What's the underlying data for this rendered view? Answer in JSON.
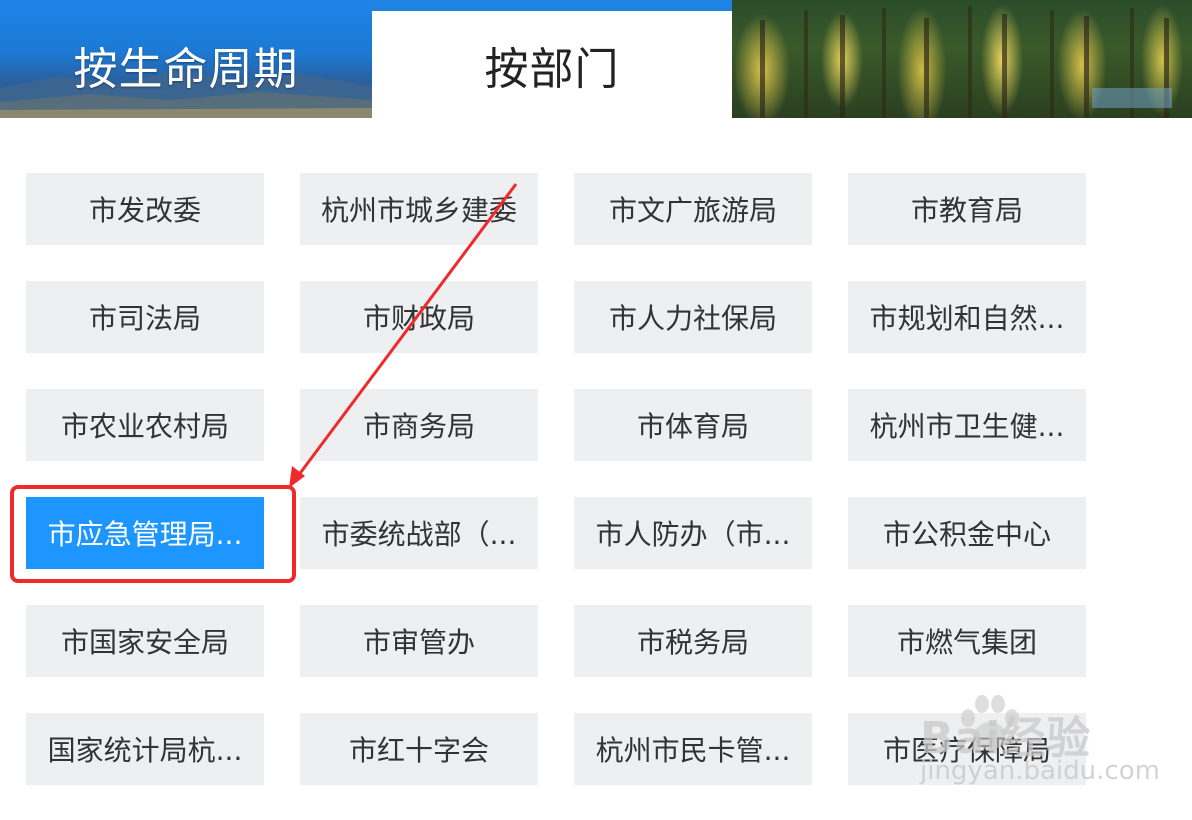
{
  "tabs": [
    {
      "label": "按生命周期",
      "active": false
    },
    {
      "label": "按部门",
      "active": true
    }
  ],
  "departments": [
    {
      "label": "市发改委",
      "active": false
    },
    {
      "label": "杭州市城乡建委",
      "active": false
    },
    {
      "label": "市文广旅游局",
      "active": false
    },
    {
      "label": "市教育局",
      "active": false
    },
    {
      "label": "市司法局",
      "active": false
    },
    {
      "label": "市财政局",
      "active": false
    },
    {
      "label": "市人力社保局",
      "active": false
    },
    {
      "label": "市规划和自然...",
      "active": false
    },
    {
      "label": "市农业农村局",
      "active": false
    },
    {
      "label": "市商务局",
      "active": false
    },
    {
      "label": "市体育局",
      "active": false
    },
    {
      "label": "杭州市卫生健...",
      "active": false
    },
    {
      "label": "市应急管理局...",
      "active": true
    },
    {
      "label": "市委统战部（...",
      "active": false
    },
    {
      "label": "市人防办（市...",
      "active": false
    },
    {
      "label": "市公积金中心",
      "active": false
    },
    {
      "label": "市国家安全局",
      "active": false
    },
    {
      "label": "市审管办",
      "active": false
    },
    {
      "label": "市税务局",
      "active": false
    },
    {
      "label": "市燃气集团",
      "active": false
    },
    {
      "label": "国家统计局杭...",
      "active": false
    },
    {
      "label": "市红十字会",
      "active": false
    },
    {
      "label": "杭州市民卡管...",
      "active": false
    },
    {
      "label": "市医疗保障局",
      "active": false
    }
  ],
  "watermark": {
    "brand": "Bai经验",
    "url": "jingyan.baidu.com"
  },
  "colors": {
    "button_bg": "#eeeff1",
    "button_text": "#333333",
    "active_bg": "#1e96ff",
    "active_text": "#ffffff",
    "annotation_red": "#f02a2a"
  }
}
